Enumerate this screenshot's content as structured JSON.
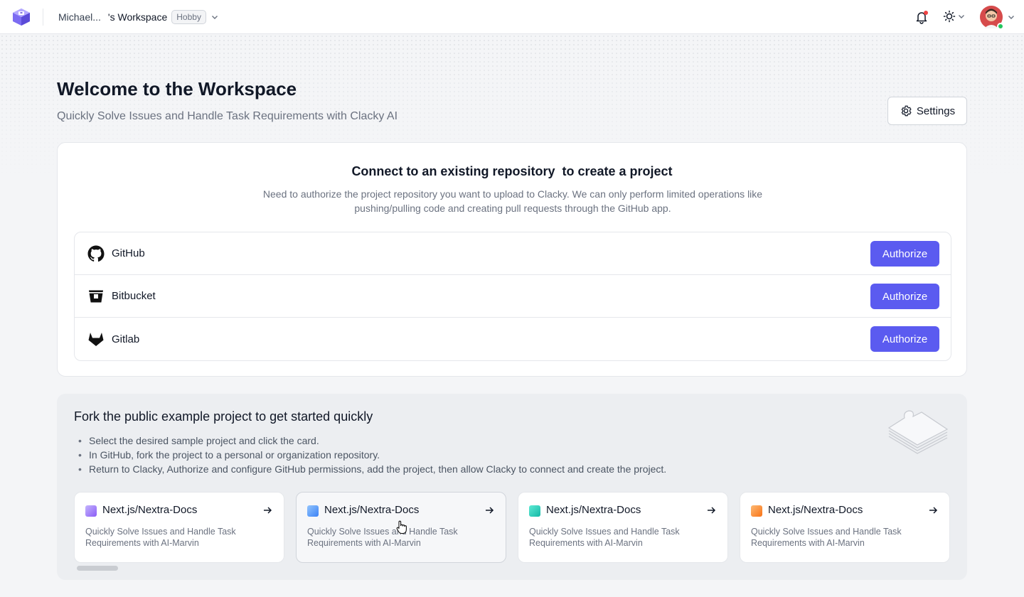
{
  "header": {
    "workspace_name": "Michael...",
    "workspace_suffix": "'s Workspace",
    "plan_badge": "Hobby"
  },
  "page": {
    "title": "Welcome to the Workspace",
    "subtitle": "Quickly Solve Issues and Handle Task Requirements with Clacky AI",
    "settings_label": "Settings"
  },
  "connect": {
    "title": "Connect to an existing repository  to create a project",
    "description": "Need to authorize the project repository you want to upload to Clacky. We can only perform limited operations like pushing/pulling code and creating pull requests through the GitHub app.",
    "providers": [
      {
        "name": "GitHub",
        "button": "Authorize",
        "icon": "github-icon"
      },
      {
        "name": "Bitbucket",
        "button": "Authorize",
        "icon": "bitbucket-icon"
      },
      {
        "name": "Gitlab",
        "button": "Authorize",
        "icon": "gitlab-icon"
      }
    ]
  },
  "fork": {
    "title": "Fork the public example project to get started quickly",
    "steps": [
      "Select the desired sample project and click the card.",
      "In GitHub, fork the project to a personal or organization repository.",
      "Return to Clacky, Authorize and configure GitHub permissions, add the project, then allow Clacky to connect and create the project."
    ],
    "cards": [
      {
        "title": "Next.js/Nextra-Docs",
        "description": "Quickly Solve Issues and Handle Task Requirements with AI-Marvin",
        "color": "#a78bfa"
      },
      {
        "title": "Next.js/Nextra-Docs",
        "description": "Quickly Solve Issues and Handle Task Requirements with AI-Marvin",
        "color": "#60a5fa"
      },
      {
        "title": "Next.js/Nextra-Docs",
        "description": "Quickly Solve Issues and Handle Task Requirements with AI-Marvin",
        "color": "#2dd4bf"
      },
      {
        "title": "Next.js/Nextra-Docs",
        "description": "Quickly Solve Issues and Handle Task Requirements with AI-Marvin",
        "color": "#fb923c"
      }
    ]
  },
  "colors": {
    "accent": "#5b5bf0",
    "notification_dot": "#ef4444",
    "online_status": "#22c55e"
  }
}
